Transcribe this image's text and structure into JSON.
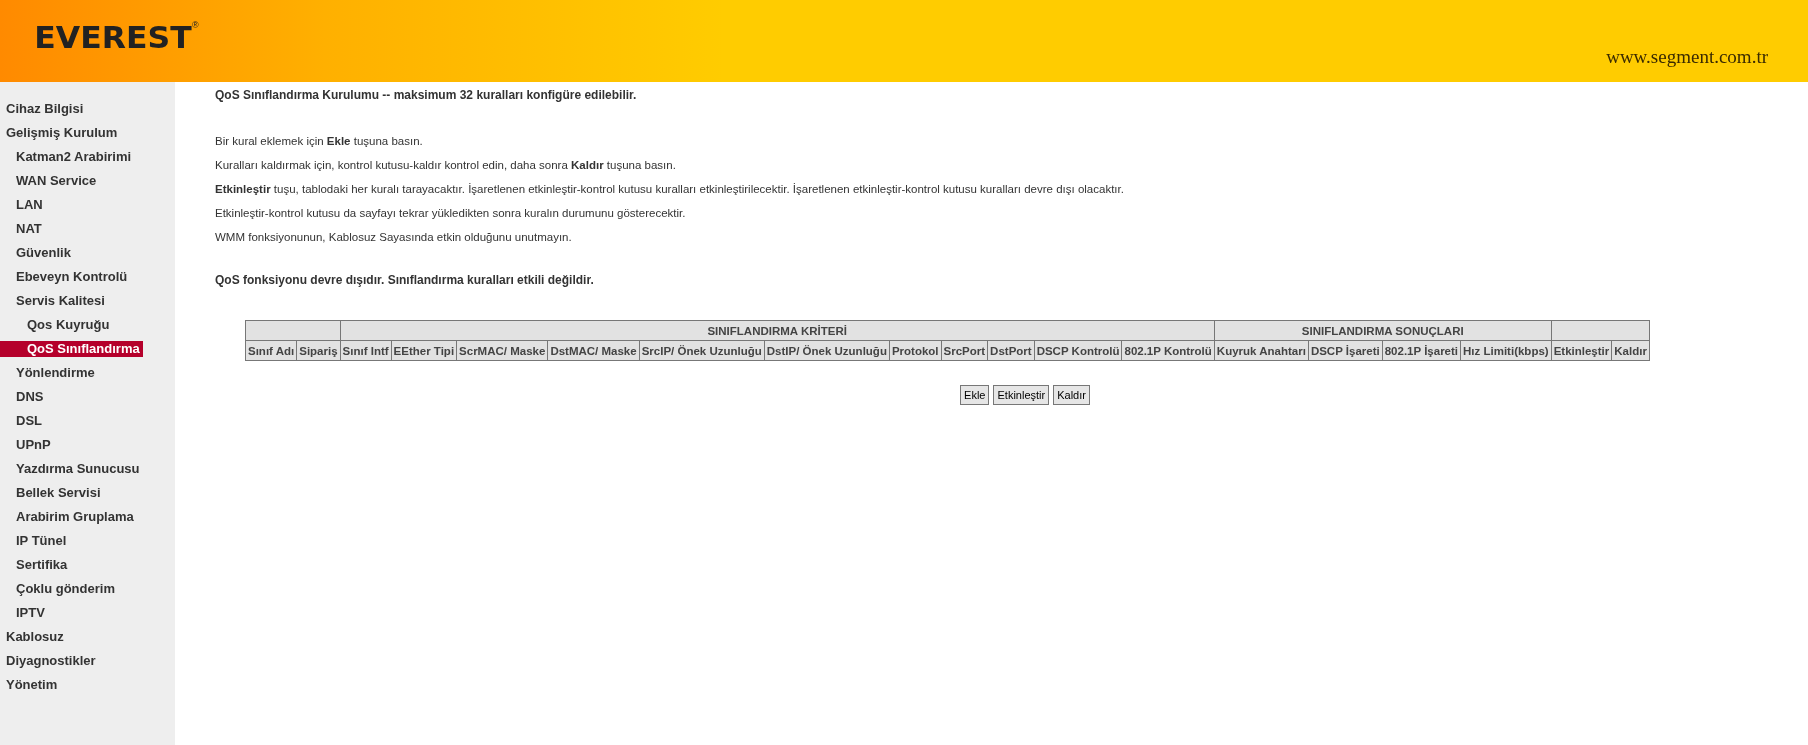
{
  "header": {
    "logo": "EVEREST",
    "logo_mark": "®",
    "url": "www.segment.com.tr"
  },
  "sidebar": {
    "items": [
      {
        "label": "Cihaz Bilgisi",
        "selected": false
      },
      {
        "label": "Gelişmiş Kurulum",
        "selected": false,
        "children": [
          {
            "label": "Katman2 Arabirimi",
            "selected": false
          },
          {
            "label": "WAN Service",
            "selected": false
          },
          {
            "label": "LAN",
            "selected": false
          },
          {
            "label": "NAT",
            "selected": false
          },
          {
            "label": "Güvenlik",
            "selected": false
          },
          {
            "label": "Ebeveyn Kontrolü",
            "selected": false
          },
          {
            "label": "Servis Kalitesi",
            "selected": false,
            "children": [
              {
                "label": "Qos Kuyruğu",
                "selected": false
              },
              {
                "label": "QoS Sınıflandırma",
                "selected": true
              }
            ]
          },
          {
            "label": "Yönlendirme",
            "selected": false
          },
          {
            "label": "DNS",
            "selected": false
          },
          {
            "label": "DSL",
            "selected": false
          },
          {
            "label": "UPnP",
            "selected": false
          },
          {
            "label": "Yazdırma Sunucusu",
            "selected": false
          },
          {
            "label": "Bellek Servisi",
            "selected": false
          },
          {
            "label": "Arabirim Gruplama",
            "selected": false
          },
          {
            "label": "IP Tünel",
            "selected": false
          },
          {
            "label": "Sertifika",
            "selected": false
          },
          {
            "label": "Çoklu gönderim",
            "selected": false
          },
          {
            "label": "IPTV",
            "selected": false
          }
        ]
      },
      {
        "label": "Kablosuz",
        "selected": false
      },
      {
        "label": "Diyagnostikler",
        "selected": false
      },
      {
        "label": "Yönetim",
        "selected": false
      }
    ]
  },
  "title": "QoS Sınıflandırma Kurulumu -- maksimum 32 kuralları konfigüre edilebilir.",
  "instructions": [
    "Bir kural eklemek için **Ekle** tuşuna basın.",
    "Kuralları kaldırmak için, kontrol kutusu-kaldır kontrol edin, daha sonra **Kaldır** tuşuna basın.",
    "**Etkinleştir** tuşu, tablodaki her kuralı tarayacaktır. İşaretlenen etkinleştir-kontrol kutusu kuralları etkinleştirilecektir. İşaretlenen etkinleştir-kontrol kutusu kuralları devre dışı olacaktır.",
    "Etkinleştir-kontrol kutusu da sayfayı tekrar yükledikten sonra kuralın durumunu gösterecektir.",
    "WMM fonksiyonunun, Kablosuz Sayasında etkin olduğunu unutmayın."
  ],
  "status": "QoS fonksiyonu devre dışıdır. Sınıflandırma kuralları etkili değildir.",
  "table": {
    "groups": [
      {
        "columns": [
          "Sınıf Adı",
          "Sipariş"
        ]
      },
      {
        "label": "SINIFLANDIRMA KRİTERİ",
        "columns": [
          "Sınıf Intf",
          "EEther Tipi",
          "ScrMAC/ Maske",
          "DstMAC/ Maske",
          "SrcIP/ Önek Uzunluğu",
          "DstIP/ Önek Uzunluğu",
          "Protokol",
          "SrcPort",
          "DstPort",
          "DSCP Kontrolü",
          "802.1P Kontrolü"
        ]
      },
      {
        "label": "SINIFLANDIRMA SONUÇLARI",
        "columns": [
          "Kuyruk Anahtarı",
          "DSCP İşareti",
          "802.1P İşareti",
          "Hız Limiti(kbps)"
        ]
      },
      {
        "columns": [
          "Etkinleştir",
          "Kaldır"
        ]
      }
    ]
  },
  "buttons": [
    "Ekle",
    "Etkinleştir",
    "Kaldır"
  ]
}
